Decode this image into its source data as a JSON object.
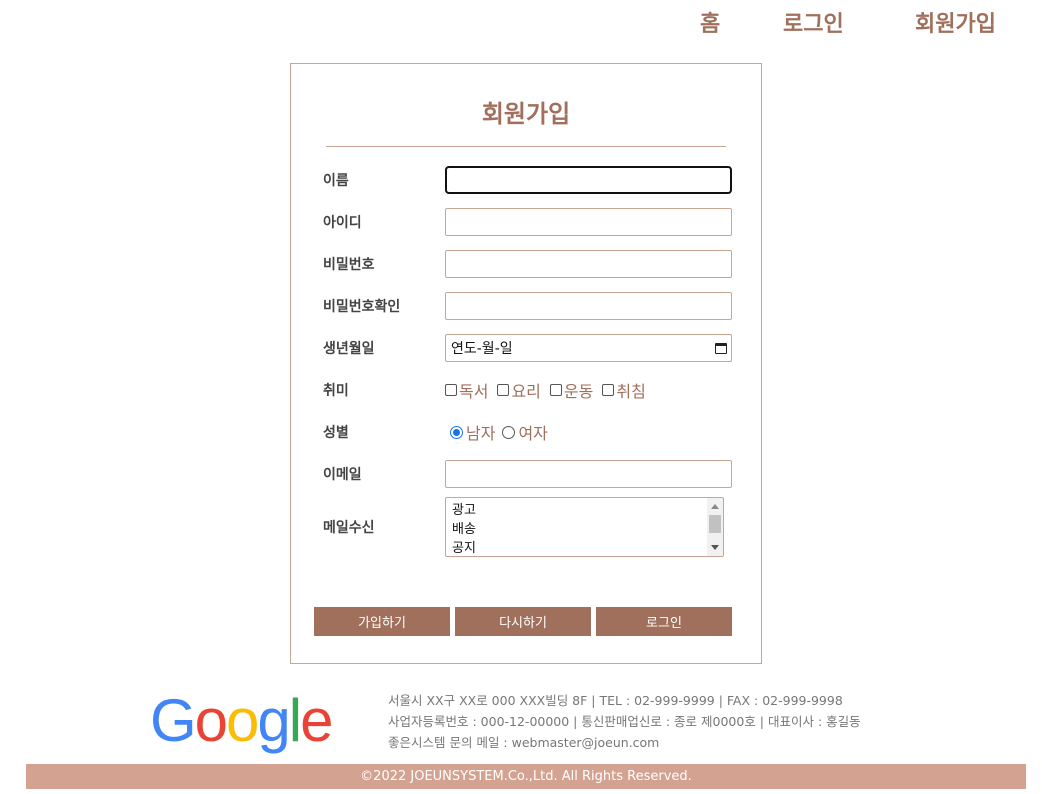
{
  "nav": {
    "home": "홈",
    "login": "로그인",
    "join": "회원가입"
  },
  "form": {
    "title": "회원가입",
    "labels": {
      "name": "이름",
      "id": "아이디",
      "password": "비밀번호",
      "password_confirm": "비밀번호확인",
      "birth": "생년월일",
      "hobby": "취미",
      "gender": "성별",
      "email": "이메일",
      "mail_receive": "메일수신"
    },
    "values": {
      "name": "",
      "id": "",
      "password": "",
      "password_confirm": "",
      "email": ""
    },
    "birth_placeholder": "연도-월-일",
    "hobbies": [
      {
        "label": "독서",
        "checked": false
      },
      {
        "label": "요리",
        "checked": false
      },
      {
        "label": "운동",
        "checked": false
      },
      {
        "label": "취침",
        "checked": false
      }
    ],
    "genders": [
      {
        "label": "남자",
        "checked": true
      },
      {
        "label": "여자",
        "checked": false
      }
    ],
    "mail_options": [
      "광고",
      "배송",
      "공지"
    ],
    "buttons": {
      "submit": "가입하기",
      "reset": "다시하기",
      "login": "로그인"
    }
  },
  "footer": {
    "logo_text": "Google",
    "address": "서울시 XX구 XX로 000 XXX빌딩 8F | TEL : 02-999-9999 | FAX : 02-999-9998",
    "business": "사업자등록번호 : 000-12-00000 | 통신판매업신로 : 종로 제0000호 | 대표이사 : 홍길동",
    "contact": "좋은시스템 문의 메일 : webmaster@joeun.com",
    "copyright": "©2022 JOEUNSYSTEM.Co.,Ltd. All Rights Reserved."
  },
  "colors": {
    "accent": "#a0705c",
    "border": "#c9a594",
    "footer_bar": "#d4a290"
  }
}
